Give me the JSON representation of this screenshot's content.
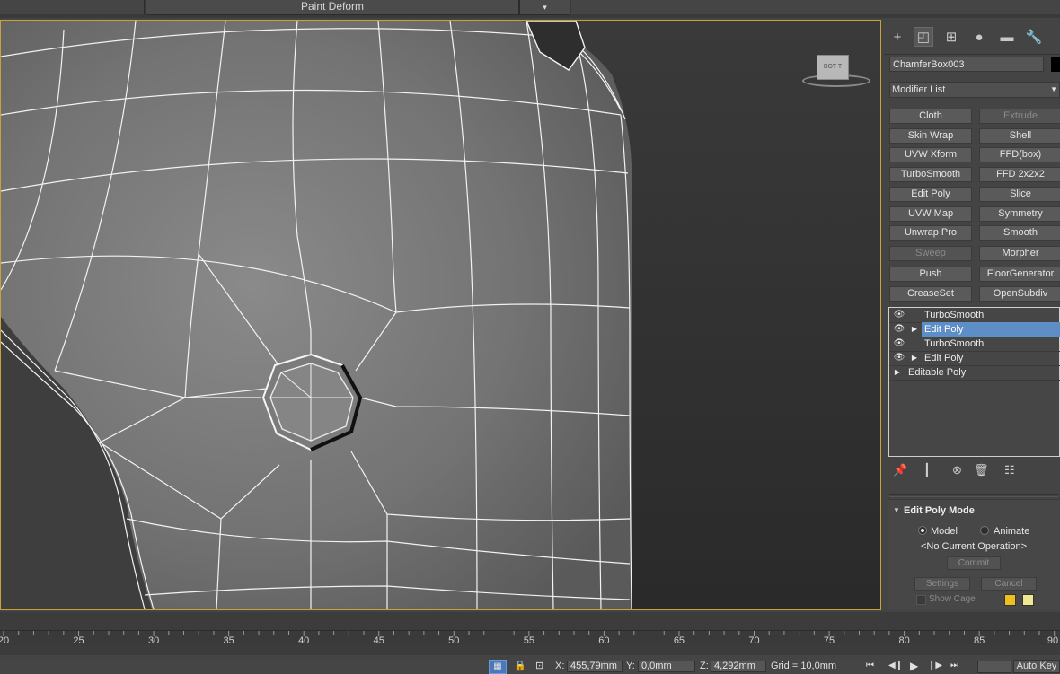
{
  "toolbar": {
    "dropdown_value": "Paint Deform",
    "dropdown_arrow": "▾"
  },
  "viewcube": {
    "face_label": "BOT",
    "face_label_side": "T"
  },
  "command_panel": {
    "tabs": [
      {
        "icon": "create-icon",
        "glyph": "+"
      },
      {
        "icon": "modify-icon",
        "glyph": "◰"
      },
      {
        "icon": "hierarchy-icon",
        "glyph": "⊞"
      },
      {
        "icon": "motion-icon",
        "glyph": "●"
      },
      {
        "icon": "display-icon",
        "glyph": "▬"
      },
      {
        "icon": "utilities-icon",
        "glyph": "🔧"
      }
    ],
    "object_name": "ChamferBox003",
    "object_color": "#000000",
    "modifier_list_label": "Modifier List",
    "modifier_buttons": [
      {
        "label": "Cloth",
        "enabled": true
      },
      {
        "label": "Extrude",
        "enabled": false
      },
      {
        "label": "Skin Wrap",
        "enabled": true
      },
      {
        "label": "Shell",
        "enabled": true
      },
      {
        "label": "UVW Xform",
        "enabled": true
      },
      {
        "label": "FFD(box)",
        "enabled": true
      },
      {
        "label": "TurboSmooth",
        "enabled": true
      },
      {
        "label": "FFD 2x2x2",
        "enabled": true
      },
      {
        "label": "Edit Poly",
        "enabled": true
      },
      {
        "label": "Slice",
        "enabled": true
      },
      {
        "label": "UVW Map",
        "enabled": true
      },
      {
        "label": "Symmetry",
        "enabled": true
      },
      {
        "label": "Unwrap Pro",
        "enabled": true
      },
      {
        "label": "Smooth",
        "enabled": true
      },
      {
        "label": "Sweep",
        "enabled": false
      },
      {
        "label": "Morpher",
        "enabled": true
      },
      {
        "label": "Push",
        "enabled": true
      },
      {
        "label": "FloorGenerator",
        "enabled": true
      },
      {
        "label": "CreaseSet",
        "enabled": true
      },
      {
        "label": "OpenSubdiv",
        "enabled": true
      }
    ],
    "stack": [
      {
        "label": "TurboSmooth",
        "eye": true,
        "expandable": false,
        "selected": false
      },
      {
        "label": "Edit Poly",
        "eye": true,
        "expandable": true,
        "selected": true
      },
      {
        "label": "TurboSmooth",
        "eye": true,
        "expandable": false,
        "selected": false
      },
      {
        "label": "Edit Poly",
        "eye": true,
        "expandable": true,
        "selected": false
      },
      {
        "label": "Editable Poly",
        "eye": false,
        "expandable": true,
        "selected": false
      }
    ],
    "stack_tools": [
      "pin-stack-icon",
      "show-end-result-icon",
      "make-unique-icon",
      "remove-modifier-icon",
      "configure-modifier-sets-icon"
    ],
    "rollout": {
      "title": "Edit Poly Mode",
      "model_label": "Model",
      "animate_label": "Animate",
      "operation_text": "<No Current Operation>",
      "commit_label": "Commit",
      "settings_label": "Settings",
      "cancel_label": "Cancel",
      "show_cage_label": "Show Cage",
      "cage_color_1": "#f0c020",
      "cage_color_2": "#f0e890"
    }
  },
  "timeline": {
    "ticks": [
      20,
      25,
      30,
      35,
      40,
      45,
      50,
      55,
      60,
      65,
      70,
      75,
      80,
      85,
      90
    ]
  },
  "status": {
    "x_label": "X:",
    "x_value": "455,79mm",
    "y_label": "Y:",
    "y_value": "0,0mm",
    "z_label": "Z:",
    "z_value": "4,292mm",
    "grid_text": "Grid = 10,0mm",
    "auto_key_label": "Auto Key"
  },
  "colors": {
    "viewport_border": "#c8a23a",
    "selection": "#5e8ec8"
  }
}
